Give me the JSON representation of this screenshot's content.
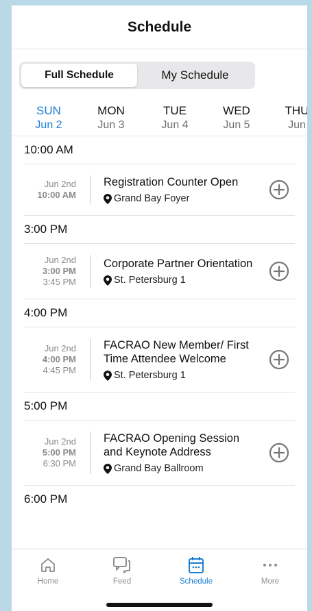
{
  "header": {
    "title": "Schedule"
  },
  "segments": [
    {
      "label": "Full Schedule",
      "active": true
    },
    {
      "label": "My Schedule",
      "active": false
    }
  ],
  "days": [
    {
      "dow": "SUN",
      "date": "Jun 2",
      "active": true
    },
    {
      "dow": "MON",
      "date": "Jun 3",
      "active": false
    },
    {
      "dow": "TUE",
      "date": "Jun 4",
      "active": false
    },
    {
      "dow": "WED",
      "date": "Jun 5",
      "active": false
    },
    {
      "dow": "THU",
      "date": "Jun",
      "active": false
    }
  ],
  "groups": [
    {
      "time": "10:00 AM",
      "events": [
        {
          "date": "Jun 2nd",
          "start": "10:00 AM",
          "end": "",
          "title": "Registration Counter Open",
          "location": "Grand Bay Foyer"
        }
      ]
    },
    {
      "time": "3:00 PM",
      "events": [
        {
          "date": "Jun 2nd",
          "start": "3:00 PM",
          "end": "3:45 PM",
          "title": "Corporate Partner Orientation",
          "location": "St. Petersburg 1"
        }
      ]
    },
    {
      "time": "4:00 PM",
      "events": [
        {
          "date": "Jun 2nd",
          "start": "4:00 PM",
          "end": "4:45 PM",
          "title": "FACRAO New Member/ First Time Attendee Welcome",
          "location": "St. Petersburg 1"
        }
      ]
    },
    {
      "time": "5:00 PM",
      "events": [
        {
          "date": "Jun 2nd",
          "start": "5:00 PM",
          "end": "6:30 PM",
          "title": "FACRAO Opening Session and Keynote Address",
          "location": "Grand Bay Ballroom"
        }
      ]
    },
    {
      "time": "6:00 PM",
      "events": []
    }
  ],
  "tabs": [
    {
      "label": "Home",
      "icon": "home-icon",
      "active": false
    },
    {
      "label": "Feed",
      "icon": "feed-icon",
      "active": false
    },
    {
      "label": "Schedule",
      "icon": "calendar-icon",
      "active": true
    },
    {
      "label": "More",
      "icon": "more-icon",
      "active": false
    }
  ],
  "colors": {
    "accent": "#1a7fd4",
    "muted": "#8a8a8e",
    "background": "#b9d9e6"
  }
}
